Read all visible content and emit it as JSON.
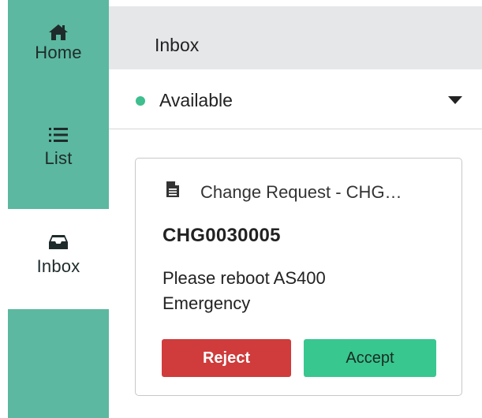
{
  "sidebar": {
    "items": [
      {
        "label": "Home",
        "icon": "home-icon"
      },
      {
        "label": "List",
        "icon": "list-icon"
      },
      {
        "label": "Inbox",
        "icon": "inbox-icon",
        "active": true
      }
    ],
    "color": "#5cb8a0"
  },
  "header": {
    "title": "Inbox"
  },
  "status": {
    "label": "Available",
    "dot_color": "#3fbe8f",
    "icon": "chevron-down-icon"
  },
  "card": {
    "icon": "document-icon",
    "title": "Change Request - CHG…",
    "number": "CHG0030005",
    "description": "Please reboot AS400 Emergency",
    "reject_label": "Reject",
    "accept_label": "Accept",
    "reject_color": "#d03b3b",
    "accept_color": "#38c78f"
  }
}
